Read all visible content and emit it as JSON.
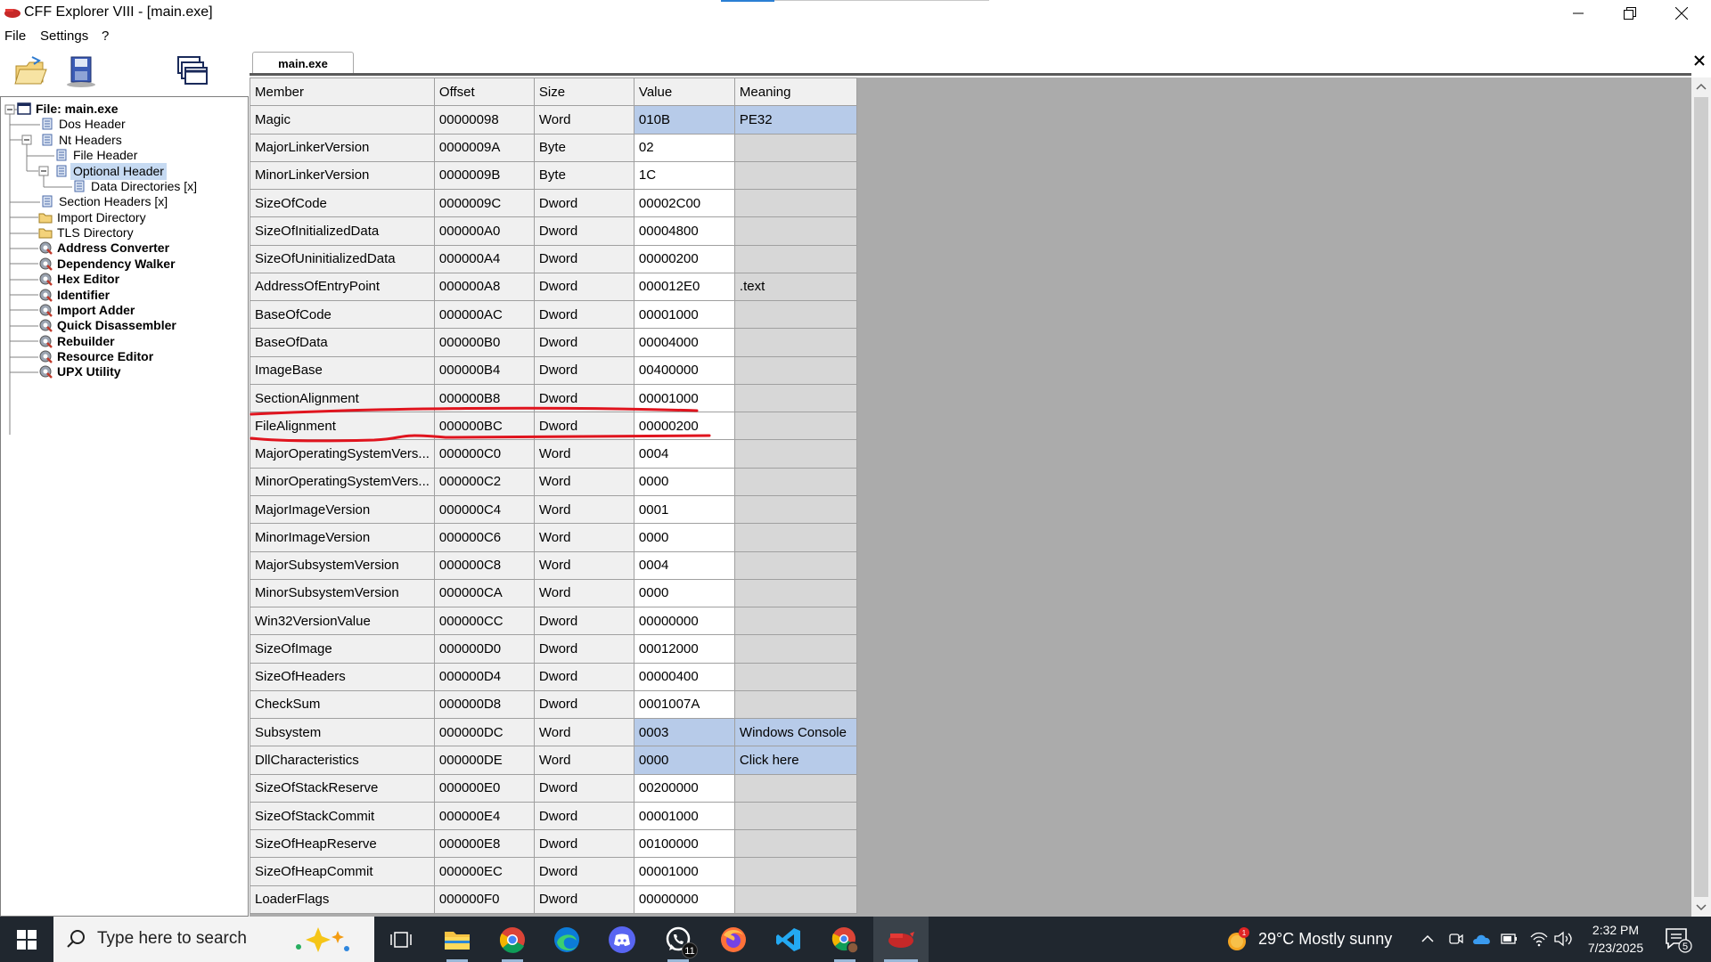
{
  "window": {
    "title": "CFF Explorer VIII - [main.exe]"
  },
  "menu": [
    "File",
    "Settings",
    "?"
  ],
  "tab": {
    "label": "main.exe",
    "close_glyph": "✕"
  },
  "tree": [
    {
      "label": "File: main.exe",
      "bold": true,
      "icon": "window-icon"
    },
    {
      "label": "Dos Header",
      "bold": false,
      "icon": "struct-icon"
    },
    {
      "label": "Nt Headers",
      "bold": false,
      "icon": "struct-icon"
    },
    {
      "label": "File Header",
      "bold": false,
      "icon": "struct-icon"
    },
    {
      "label": "Optional Header",
      "bold": false,
      "icon": "struct-icon",
      "selected": true
    },
    {
      "label": "Data Directories [x]",
      "bold": false,
      "icon": "struct-icon"
    },
    {
      "label": "Section Headers [x]",
      "bold": false,
      "icon": "struct-icon"
    },
    {
      "label": "Import Directory",
      "bold": false,
      "icon": "folder-icon"
    },
    {
      "label": "TLS Directory",
      "bold": false,
      "icon": "folder-icon"
    },
    {
      "label": "Address Converter",
      "bold": true,
      "icon": "tool-icon"
    },
    {
      "label": "Dependency Walker",
      "bold": true,
      "icon": "tool-icon"
    },
    {
      "label": "Hex Editor",
      "bold": true,
      "icon": "tool-icon"
    },
    {
      "label": "Identifier",
      "bold": true,
      "icon": "tool-icon"
    },
    {
      "label": "Import Adder",
      "bold": true,
      "icon": "tool-icon"
    },
    {
      "label": "Quick Disassembler",
      "bold": true,
      "icon": "tool-icon"
    },
    {
      "label": "Rebuilder",
      "bold": true,
      "icon": "tool-icon"
    },
    {
      "label": "Resource Editor",
      "bold": true,
      "icon": "tool-icon"
    },
    {
      "label": "UPX Utility",
      "bold": true,
      "icon": "tool-icon"
    }
  ],
  "table": {
    "columns": [
      "Member",
      "Offset",
      "Size",
      "Value",
      "Meaning"
    ],
    "rows": [
      [
        "Magic",
        "00000098",
        "Word",
        "010B",
        "PE32"
      ],
      [
        "MajorLinkerVersion",
        "0000009A",
        "Byte",
        "02",
        ""
      ],
      [
        "MinorLinkerVersion",
        "0000009B",
        "Byte",
        "1C",
        ""
      ],
      [
        "SizeOfCode",
        "0000009C",
        "Dword",
        "00002C00",
        ""
      ],
      [
        "SizeOfInitializedData",
        "000000A0",
        "Dword",
        "00004800",
        ""
      ],
      [
        "SizeOfUninitializedData",
        "000000A4",
        "Dword",
        "00000200",
        ""
      ],
      [
        "AddressOfEntryPoint",
        "000000A8",
        "Dword",
        "000012E0",
        ".text"
      ],
      [
        "BaseOfCode",
        "000000AC",
        "Dword",
        "00001000",
        ""
      ],
      [
        "BaseOfData",
        "000000B0",
        "Dword",
        "00004000",
        ""
      ],
      [
        "ImageBase",
        "000000B4",
        "Dword",
        "00400000",
        ""
      ],
      [
        "SectionAlignment",
        "000000B8",
        "Dword",
        "00001000",
        ""
      ],
      [
        "FileAlignment",
        "000000BC",
        "Dword",
        "00000200",
        ""
      ],
      [
        "MajorOperatingSystemVers...",
        "000000C0",
        "Word",
        "0004",
        ""
      ],
      [
        "MinorOperatingSystemVers...",
        "000000C2",
        "Word",
        "0000",
        ""
      ],
      [
        "MajorImageVersion",
        "000000C4",
        "Word",
        "0001",
        ""
      ],
      [
        "MinorImageVersion",
        "000000C6",
        "Word",
        "0000",
        ""
      ],
      [
        "MajorSubsystemVersion",
        "000000C8",
        "Word",
        "0004",
        ""
      ],
      [
        "MinorSubsystemVersion",
        "000000CA",
        "Word",
        "0000",
        ""
      ],
      [
        "Win32VersionValue",
        "000000CC",
        "Dword",
        "00000000",
        ""
      ],
      [
        "SizeOfImage",
        "000000D0",
        "Dword",
        "00012000",
        ""
      ],
      [
        "SizeOfHeaders",
        "000000D4",
        "Dword",
        "00000400",
        ""
      ],
      [
        "CheckSum",
        "000000D8",
        "Dword",
        "0001007A",
        ""
      ],
      [
        "Subsystem",
        "000000DC",
        "Word",
        "0003",
        "Windows Console"
      ],
      [
        "DllCharacteristics",
        "000000DE",
        "Word",
        "0000",
        "Click here"
      ],
      [
        "SizeOfStackReserve",
        "000000E0",
        "Dword",
        "00200000",
        ""
      ],
      [
        "SizeOfStackCommit",
        "000000E4",
        "Dword",
        "00001000",
        ""
      ],
      [
        "SizeOfHeapReserve",
        "000000E8",
        "Dword",
        "00100000",
        ""
      ],
      [
        "SizeOfHeapCommit",
        "000000EC",
        "Dword",
        "00001000",
        ""
      ],
      [
        "LoaderFlags",
        "000000F0",
        "Dword",
        "00000000",
        ""
      ]
    ],
    "highlighted_rows": [
      "Magic",
      "Subsystem",
      "DllCharacteristics"
    ],
    "annotated_rows": [
      "SectionAlignment",
      "FileAlignment"
    ]
  },
  "taskbar": {
    "search_placeholder": "Type here to search",
    "apps": [
      {
        "name": "task-view-icon"
      },
      {
        "name": "file-explorer-icon"
      },
      {
        "name": "chrome-icon"
      },
      {
        "name": "edge-icon"
      },
      {
        "name": "discord-icon"
      },
      {
        "name": "whatsapp-icon",
        "badge": "11"
      },
      {
        "name": "firefox-icon"
      },
      {
        "name": "vscode-icon"
      },
      {
        "name": "chrome-profile-icon"
      },
      {
        "name": "cff-explorer-icon",
        "active": true
      }
    ],
    "weather": {
      "temp": "29°C",
      "condition": "Mostly sunny",
      "alert_badge": "1"
    },
    "clock": {
      "time": "2:32 PM",
      "date": "7/23/2025"
    },
    "notifications_count": "5"
  },
  "colors": {
    "selection": "#c6daf2",
    "value_highlight": "#b7cbe9",
    "annotation_red": "#e0141e",
    "taskbar": "#20272f"
  }
}
